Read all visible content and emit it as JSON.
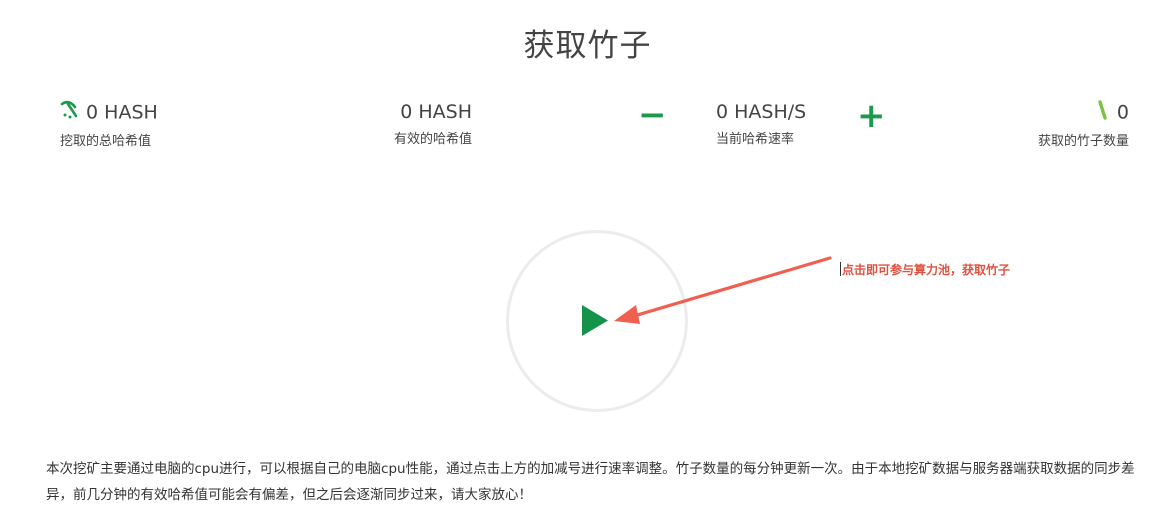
{
  "title": "获取竹子",
  "stats": {
    "total_hash": {
      "value": "0 HASH",
      "label": "挖取的总哈希值"
    },
    "valid_hash": {
      "value": "0 HASH",
      "label": "有效的哈希值"
    },
    "rate": {
      "value": "0 HASH/S",
      "label": "当前哈希速率"
    },
    "bamboo": {
      "value": "0",
      "label": "获取的竹子数量"
    }
  },
  "controls": {
    "decrease": "−",
    "increase": "+"
  },
  "annotation": "点击即可参与算力池，获取竹子",
  "description": "本次挖矿主要通过电脑的cpu进行，可以根据自己的电脑cpu性能，通过点击上方的加减号进行速率调整。竹子数量的每分钟更新一次。由于本地挖矿数据与服务器端获取数据的同步差异，前几分钟的有效哈希值可能会有偏差，但之后会逐渐同步过来，请大家放心！",
  "colors": {
    "accent": "#1a9a4b",
    "annotation": "#e0513f",
    "circle": "#ececec"
  },
  "icons": {
    "mining": "pickaxe-icon",
    "bamboo": "bamboo-icon",
    "start": "play-icon"
  }
}
